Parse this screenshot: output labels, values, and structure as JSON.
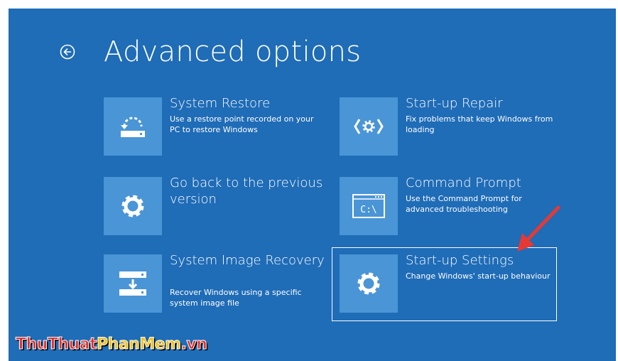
{
  "page": {
    "title": "Advanced options",
    "back_icon": "back-arrow-icon",
    "background": "#1f6cb7",
    "tile_color": "#4a95d6"
  },
  "options": [
    {
      "id": "system-restore",
      "title": "System Restore",
      "description": "Use a restore point recorded on your PC to restore Windows",
      "icon": "system-restore-icon"
    },
    {
      "id": "startup-repair",
      "title": "Start-up Repair",
      "description": "Fix problems that keep Windows from loading",
      "icon": "startup-repair-icon"
    },
    {
      "id": "go-back",
      "title": "Go back to the previous version",
      "description": "",
      "icon": "gear-icon"
    },
    {
      "id": "command-prompt",
      "title": "Command Prompt",
      "description": "Use the Command Prompt for advanced troubleshooting",
      "icon": "command-prompt-icon",
      "icon_text": "C:\\"
    },
    {
      "id": "system-image-recovery",
      "title": "System Image Recovery",
      "description": "Recover Windows using a specific system image file",
      "icon": "system-image-icon"
    },
    {
      "id": "startup-settings",
      "title": "Start-up Settings",
      "description": "Change Windows' start-up behaviour",
      "icon": "gear-icon",
      "highlighted": true
    }
  ],
  "annotation": {
    "color": "#e53935"
  },
  "watermark": {
    "part1": "ThuThuat",
    "part2": "PhanMem",
    "part3": ".vn"
  }
}
